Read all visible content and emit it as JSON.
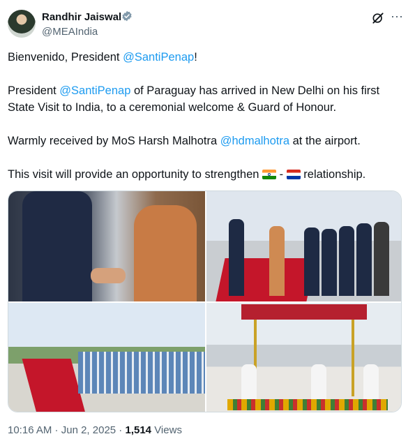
{
  "author": {
    "name": "Randhir Jaiswal",
    "handle": "@MEAIndia"
  },
  "tweet": {
    "p1_a": "Bienvenido, President ",
    "p1_link": "@SantiPenap",
    "p1_b": "!",
    "p2_a": "President ",
    "p2_link": "@SantiPenap",
    "p2_b": " of Paraguay has arrived in New Delhi on his first State Visit to India, to a ceremonial welcome & Guard of Honour.",
    "p3_a": "Warmly received by MoS Harsh Malhotra ",
    "p3_link": "@hdmalhotra",
    "p3_b": " at the airport.",
    "p4_a": "This visit will provide an opportunity to strengthen ",
    "p4_dash": " - ",
    "p4_b": " relationship."
  },
  "meta": {
    "time": "10:16 AM",
    "sep1": " · ",
    "date": "Jun 2, 2025",
    "sep2": " · ",
    "views": "1,514",
    "views_label": " Views"
  },
  "colors": {
    "link": "#1d9bf0",
    "verified": "#829aab"
  },
  "icons": {
    "verified": "verified-badge-icon",
    "grok": "grok-icon",
    "more": "more-icon"
  }
}
